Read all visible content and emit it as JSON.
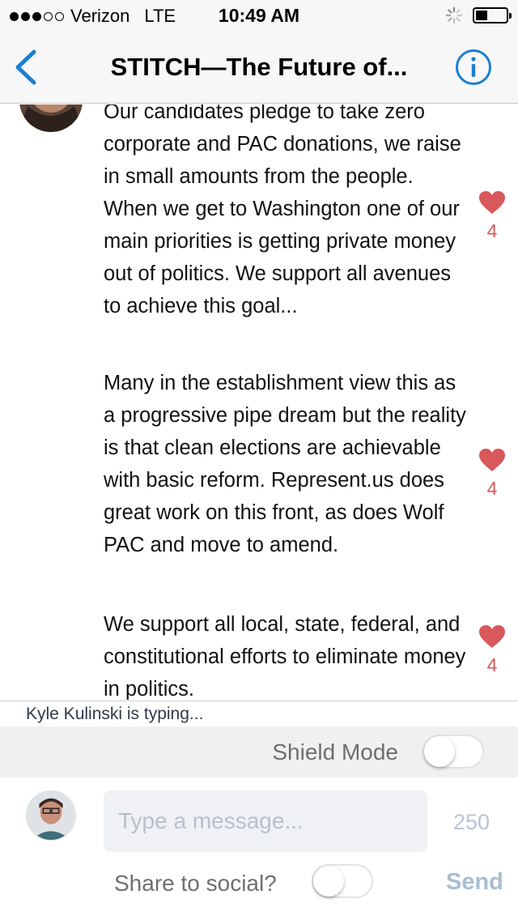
{
  "status_bar": {
    "carrier": "Verizon",
    "network": "LTE",
    "time": "10:49 AM",
    "signal_bars_filled": 3,
    "signal_bars_total": 5,
    "battery_level": 0.4
  },
  "nav": {
    "title": "STITCH—The Future of...",
    "back_icon": "chevron-left-icon",
    "info_icon": "info-circle-icon",
    "accent_color": "#1d7fd1"
  },
  "messages": [
    {
      "text": "Our candidates pledge to take zero corporate and PAC donations, we raise in small amounts from the people. When we get to Washington one of our main priorities is getting private money out of politics. We support all avenues to achieve this goal...",
      "likes": "4"
    },
    {
      "text": "Many in the establishment view this as a progressive pipe dream but the reality is that clean elections are achievable with basic reform. Represent.us does great work on this front, as does Wolf PAC and move to amend.",
      "likes": "4"
    },
    {
      "text": "We support all local, state, federal, and constitutional efforts to eliminate money in politics.",
      "likes": "4"
    }
  ],
  "like_color": "#d9585c",
  "typing_indicator": "Kyle Kulinski is typing...",
  "shield": {
    "label": "Shield Mode",
    "on": false
  },
  "composer": {
    "placeholder": "Type a message...",
    "value": "",
    "char_count": "250",
    "share_label": "Share to social?",
    "share_on": false,
    "send_label": "Send"
  }
}
